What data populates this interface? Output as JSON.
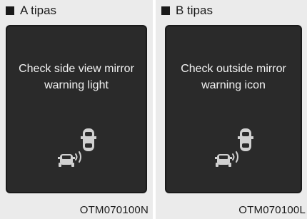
{
  "panels": [
    {
      "title": "A tipas",
      "message_lines": [
        "Check side view mirror",
        "warning light"
      ],
      "code": "OTM070100N",
      "icon": "blind-spot-cars-icon"
    },
    {
      "title": "B tipas",
      "message_lines": [
        "Check outside mirror",
        "warning icon"
      ],
      "code": "OTM070100L",
      "icon": "blind-spot-cars-icon"
    }
  ],
  "colors": {
    "panel_bg": "#ebebeb",
    "screen_bg": "#2a2a2a",
    "screen_text": "#f2f2f2",
    "text": "#1a1a1a"
  }
}
